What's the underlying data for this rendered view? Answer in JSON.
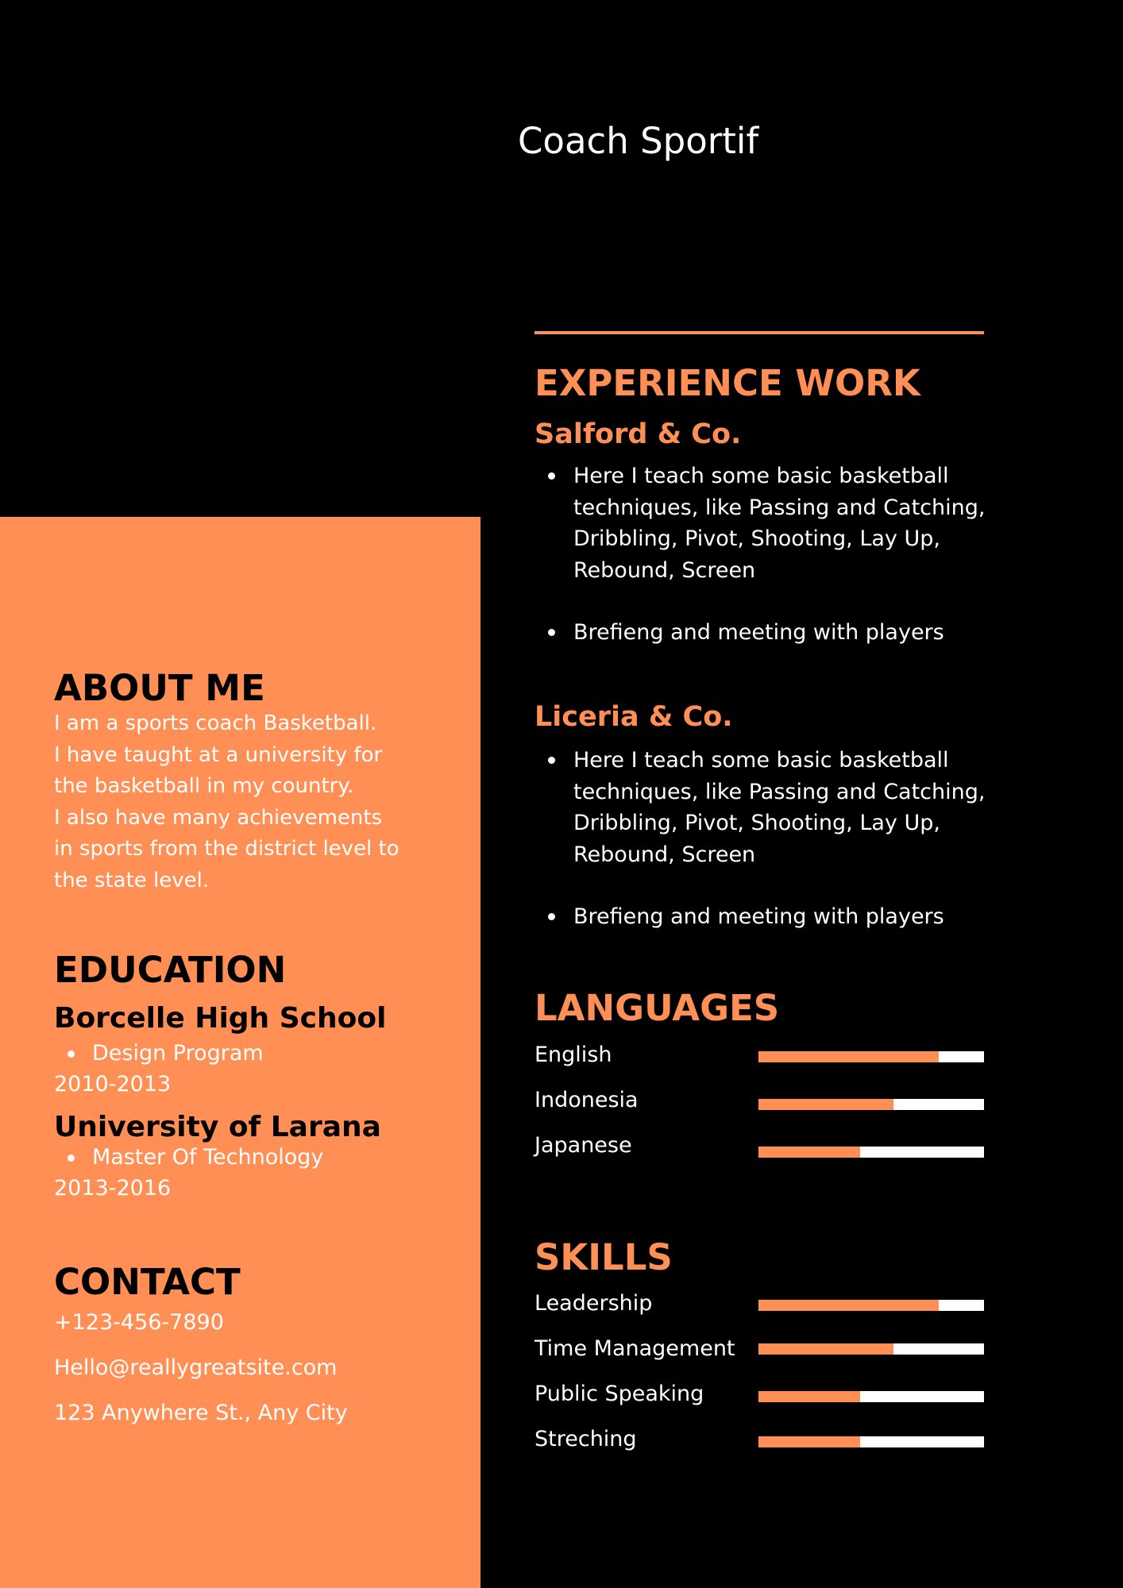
{
  "header": {
    "job_title": "Coach Sportif"
  },
  "colors": {
    "accent": "#FF8F55",
    "background": "#000000",
    "text_light": "#FFFFFF",
    "text_dark": "#000000"
  },
  "experience": {
    "title": "EXPERIENCE WORK",
    "jobs": [
      {
        "company": "Salford & Co.",
        "bullets": [
          "Here I teach some basic basketball techniques, like Passing and Catching, Dribbling, Pivot, Shooting, Lay Up, Rebound, Screen",
          "Brefieng and meeting with players"
        ]
      },
      {
        "company": "Liceria & Co.",
        "bullets": [
          "Here I teach some basic basketball techniques, like Passing and Catching, Dribbling, Pivot, Shooting, Lay Up, Rebound, Screen",
          "Brefieng and meeting with players"
        ]
      }
    ]
  },
  "languages": {
    "title": "LANGUAGES",
    "items": [
      {
        "label": "English",
        "level": 0.8
      },
      {
        "label": "Indonesia",
        "level": 0.6
      },
      {
        "label": "Japanese",
        "level": 0.45
      }
    ]
  },
  "skills": {
    "title": "SKILLS",
    "items": [
      {
        "label": "Leadership",
        "level": 0.8
      },
      {
        "label": "Time Management",
        "level": 0.6
      },
      {
        "label": "Public Speaking",
        "level": 0.45
      },
      {
        "label": "Streching",
        "level": 0.45
      }
    ]
  },
  "about": {
    "title": "ABOUT ME",
    "text": "I am a sports coach Basketball.\nI have taught at a university for\nthe basketball in my country.\nI also have many achievements\nin sports from the district level to\n the state level."
  },
  "education": {
    "title": "EDUCATION",
    "items": [
      {
        "school": "Borcelle High School",
        "program": "Design Program",
        "years": "2010-2013"
      },
      {
        "school": "University of Larana",
        "program": "Master Of Technology",
        "years": "2013-2016"
      }
    ]
  },
  "contact": {
    "title": "CONTACT",
    "phone": "+123-456-7890",
    "email": "Hello@reallygreatsite.com",
    "address": "123 Anywhere St., Any City"
  }
}
